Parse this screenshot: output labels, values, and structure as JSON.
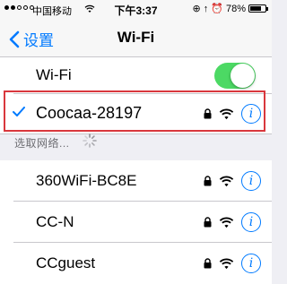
{
  "status_bar": {
    "carrier": "中国移动",
    "time": "下午3:37",
    "battery_text": "78%",
    "battery_level": 0.78,
    "signal_full": 2,
    "signal_total": 5
  },
  "nav": {
    "back_label": "设置",
    "title": "Wi-Fi"
  },
  "wifi_toggle": {
    "label": "Wi-Fi",
    "on": true
  },
  "connected_network": {
    "name": "Coocaa-28197",
    "secured": true
  },
  "section_header": "选取网络...",
  "networks": [
    {
      "name": "360WiFi-BC8E",
      "secured": true
    },
    {
      "name": "CC-N",
      "secured": true
    },
    {
      "name": "CCguest",
      "secured": true
    }
  ],
  "colors": {
    "accent": "#007aff",
    "toggle_on": "#4cd964",
    "highlight": "#d9373d"
  },
  "icons": {
    "back": "chevron-left-icon",
    "check": "checkmark-icon",
    "lock": "lock-icon",
    "wifi": "wifi-icon",
    "info": "info-icon",
    "spinner": "spinner-icon"
  }
}
